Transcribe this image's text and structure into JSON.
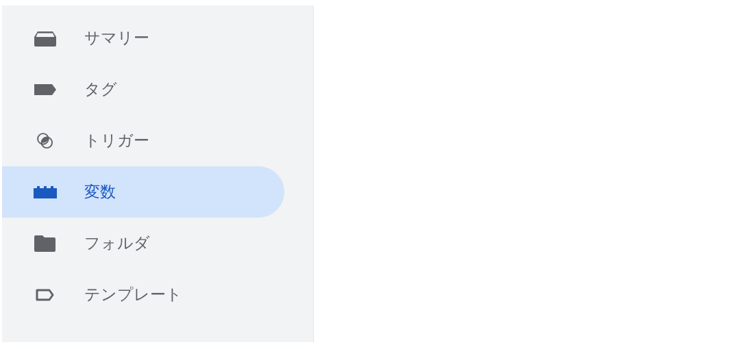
{
  "sidebar": {
    "items": [
      {
        "label": "サマリー",
        "selected": false
      },
      {
        "label": "タグ",
        "selected": false
      },
      {
        "label": "トリガー",
        "selected": false
      },
      {
        "label": "変数",
        "selected": true
      },
      {
        "label": "フォルダ",
        "selected": false
      },
      {
        "label": "テンプレート",
        "selected": false
      }
    ]
  }
}
